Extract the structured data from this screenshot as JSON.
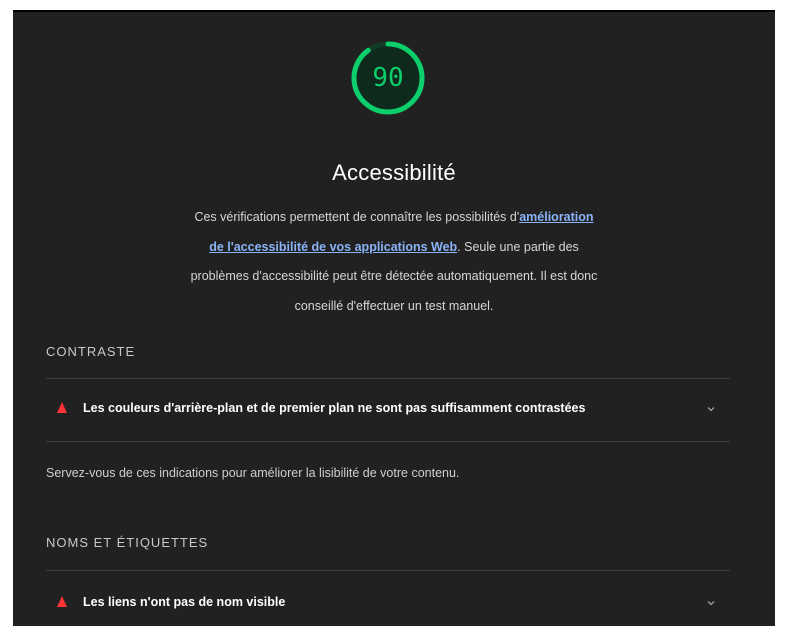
{
  "category": {
    "score": "90",
    "score_color": "#0cce6b",
    "score_fraction": 0.9,
    "title": "Accessibilité",
    "description": {
      "prefix": "Ces vérifications permettent de connaître les possibilités d'",
      "link_text": "amélioration de l'accessibilité de vos applications Web",
      "suffix": ". Seule une partie des problèmes d'accessibilité peut être détectée automatiquement. Il est donc conseillé d'effectuer un test manuel."
    }
  },
  "groups": [
    {
      "title": "CONTRASTE",
      "audits": [
        {
          "label": "Les couleurs d'arrière-plan et de premier plan ne sont pas suffisamment contrastées",
          "status_icon": "warning-triangle-icon",
          "expand_icon": "chevron-down-icon"
        }
      ],
      "hint": "Servez-vous de ces indications pour améliorer la lisibilité de votre contenu."
    },
    {
      "title": "NOMS ET ÉTIQUETTES",
      "audits": [
        {
          "label": "Les liens n'ont pas de nom visible",
          "status_icon": "warning-triangle-icon",
          "expand_icon": "chevron-down-icon"
        }
      ]
    }
  ],
  "colors": {
    "background": "#212121",
    "fail": "#ff3333",
    "link": "#8ab4f8"
  }
}
